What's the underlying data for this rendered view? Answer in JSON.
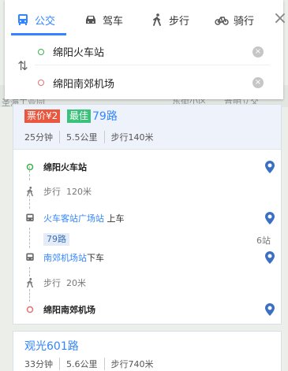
{
  "tabs": [
    {
      "label": "公交",
      "icon": "bus-icon"
    },
    {
      "label": "驾车",
      "icon": "car-icon"
    },
    {
      "label": "步行",
      "icon": "walk-icon"
    },
    {
      "label": "骑行",
      "icon": "bike-icon"
    }
  ],
  "search": {
    "start": "绵阳火车站",
    "end": "绵阳南郊机场"
  },
  "map_labels": {
    "left": "圣海工业园",
    "mid": "东街小区",
    "right": "普明立交"
  },
  "route1": {
    "price_badge": "票价¥2",
    "best_badge": "最佳",
    "name": "79路",
    "duration": "25分钟",
    "distance": "5.5公里",
    "walk": "步行140米",
    "steps": {
      "start": "绵阳火车站",
      "walk1": "步行",
      "walk1_dist": "120米",
      "board_stop": "火车客站广场站",
      "board_action": "上车",
      "line": "79路",
      "stops": "6站",
      "alight_stop": "南郊机场站",
      "alight_action": "下车",
      "walk2": "步行",
      "walk2_dist": "20米",
      "end": "绵阳南郊机场"
    }
  },
  "route2": {
    "name": "观光601路",
    "duration": "33分钟",
    "distance": "5.6公里",
    "walk": "步行740米"
  },
  "colors": {
    "accent": "#3385ff",
    "price": "#e8573e",
    "best": "#3ac17a"
  }
}
